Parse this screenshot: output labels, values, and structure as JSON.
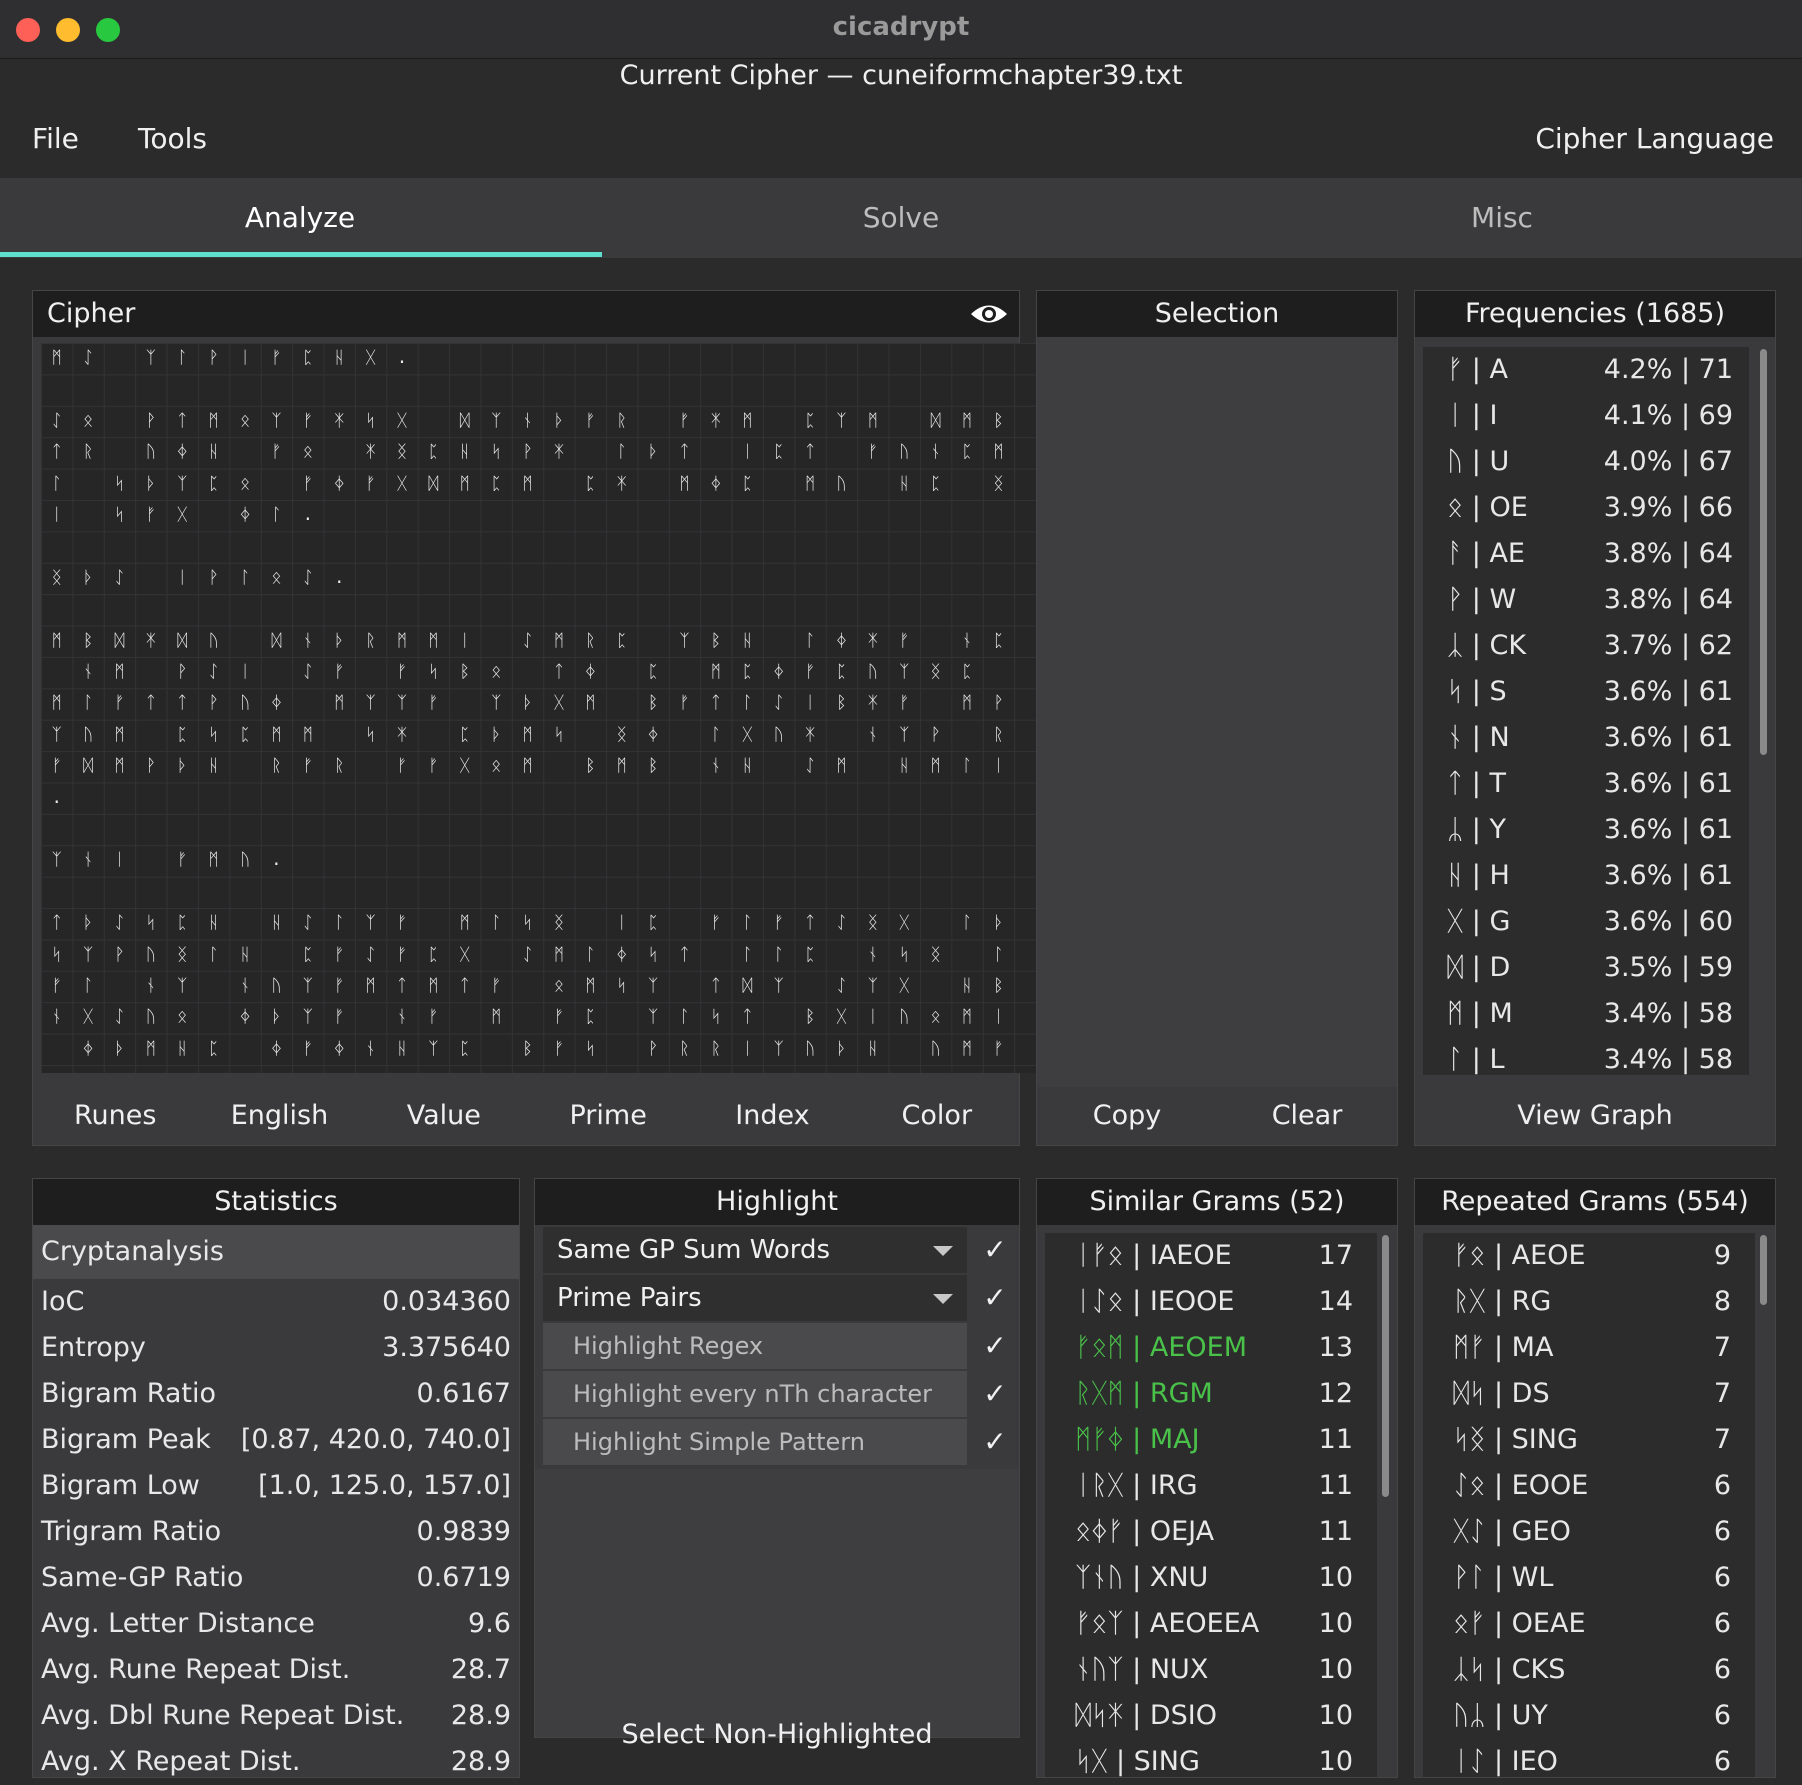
{
  "window": {
    "app_title": "cicadrypt",
    "subtitle": "Current Cipher — cuneiformchapter39.txt"
  },
  "menu": {
    "file": "File",
    "tools": "Tools",
    "cipher_language": "Cipher Language"
  },
  "tabs": [
    "Analyze",
    "Solve",
    "Misc"
  ],
  "cipher": {
    "title": "Cipher",
    "buttons": [
      "Runes",
      "English",
      "Value",
      "Prime",
      "Index",
      "Color"
    ],
    "rows": [
      [
        "ᛗ",
        "ᛇ",
        "",
        "ᛉ",
        "ᛚ",
        "ᚹ",
        "ᛁ",
        "ᚠ",
        "ᛈ",
        "ᚺ",
        "ᚷ",
        "."
      ],
      [],
      [
        "ᛇ",
        "ᛟ",
        "",
        "ᚹ",
        "ᛏ",
        "ᛗ",
        "ᛟ",
        "ᛉ",
        "ᚠ",
        "ᛡ",
        "ᛋ",
        "ᚷ",
        "",
        "ᛞ",
        "ᛉ",
        "ᚾ",
        "ᚦ",
        "ᚠ",
        "ᚱ",
        "",
        "ᚠ",
        "ᛡ",
        "ᛗ",
        "",
        "ᛈ",
        "ᛉ",
        "ᛗ",
        "",
        "ᛞ",
        "ᛗ",
        "ᛒ"
      ],
      [
        "ᛏ",
        "ᚱ",
        "",
        "ᚢ",
        "ᛄ",
        "ᚺ",
        "",
        "ᚠ",
        "ᛟ",
        "",
        "ᛡ",
        "ᛝ",
        "ᛈ",
        "ᚺ",
        "ᛋ",
        "ᚹ",
        "ᛡ",
        "",
        "ᛚ",
        "ᚦ",
        "ᛏ",
        "",
        "ᛁ",
        "ᛈ",
        "ᛏ",
        "",
        "ᚠ",
        "ᚢ",
        "ᚾ",
        "ᛈ",
        "ᛗ"
      ],
      [
        "ᛚ",
        "",
        "ᛋ",
        "ᚦ",
        "ᛉ",
        "ᛈ",
        "ᛟ",
        "",
        "ᚠ",
        "ᛄ",
        "ᚠ",
        "ᚷ",
        "ᛞ",
        "ᛗ",
        "ᛈ",
        "ᛗ",
        "",
        "ᛈ",
        "ᛡ",
        "",
        "ᛗ",
        "ᛄ",
        "ᛈ",
        "",
        "ᛗ",
        "ᚢ",
        "",
        "ᚺ",
        "ᛈ",
        "",
        "ᛝ"
      ],
      [
        "ᛁ",
        "",
        "ᛋ",
        "ᚠ",
        "ᚷ",
        "",
        "ᛄ",
        "ᛚ",
        "."
      ],
      [],
      [
        "ᛝ",
        "ᚦ",
        "ᛇ",
        "",
        "ᛁ",
        "ᚹ",
        "ᛚ",
        "ᛟ",
        "ᛇ",
        "."
      ],
      [],
      [
        "ᛗ",
        "ᛒ",
        "ᛞ",
        "ᛡ",
        "ᛞ",
        "ᚢ",
        "",
        "ᛞ",
        "ᚾ",
        "ᚦ",
        "ᚱ",
        "ᛗ",
        "ᛗ",
        "ᛁ",
        "",
        "ᛇ",
        "ᛗ",
        "ᚱ",
        "ᛈ",
        "",
        "ᛉ",
        "ᛒ",
        "ᚺ",
        "",
        "ᛚ",
        "ᛄ",
        "ᛡ",
        "ᚠ",
        "",
        "ᚾ",
        "ᛈ"
      ],
      [
        "",
        "ᚾ",
        "ᛗ",
        "",
        "ᚹ",
        "ᛇ",
        "ᛁ",
        "",
        "ᛇ",
        "ᚠ",
        "",
        "ᚠ",
        "ᛋ",
        "ᛒ",
        "ᛟ",
        "",
        "ᛏ",
        "ᛄ",
        "",
        "ᛈ",
        "",
        "ᛗ",
        "ᛈ",
        "ᛄ",
        "ᚠ",
        "ᛈ",
        "ᚢ",
        "ᛉ",
        "ᛝ",
        "ᛈ"
      ],
      [
        "ᛗ",
        "ᛚ",
        "ᚠ",
        "ᛏ",
        "ᛏ",
        "ᚹ",
        "ᚢ",
        "ᛄ",
        "",
        "ᛗ",
        "ᛉ",
        "ᛉ",
        "ᚠ",
        "",
        "ᛉ",
        "ᚦ",
        "ᚷ",
        "ᛗ",
        "",
        "ᛒ",
        "ᚠ",
        "ᛏ",
        "ᛚ",
        "ᛇ",
        "ᛁ",
        "ᛒ",
        "ᛡ",
        "ᚠ",
        "",
        "ᛗ",
        "ᚹ"
      ],
      [
        "ᛉ",
        "ᚢ",
        "ᛗ",
        "",
        "ᛈ",
        "ᛋ",
        "ᛈ",
        "ᛗ",
        "ᛗ",
        "",
        "ᛋ",
        "ᛡ",
        "",
        "ᛈ",
        "ᚦ",
        "ᛗ",
        "ᛋ",
        "",
        "ᛝ",
        "ᛄ",
        "",
        "ᛚ",
        "ᚷ",
        "ᚢ",
        "ᛡ",
        "",
        "ᚾ",
        "ᛉ",
        "ᚹ",
        "",
        "ᚱ"
      ],
      [
        "ᚠ",
        "ᛞ",
        "ᛗ",
        "ᚹ",
        "ᚦ",
        "ᚺ",
        "",
        "ᚱ",
        "ᚠ",
        "ᚱ",
        "",
        "ᚠ",
        "ᚠ",
        "ᚷ",
        "ᛟ",
        "ᛗ",
        "",
        "ᛒ",
        "ᛗ",
        "ᛒ",
        "",
        "ᚾ",
        "ᚺ",
        "",
        "ᛇ",
        "ᛗ",
        "",
        "ᚺ",
        "ᛗ",
        "ᛚ",
        "ᛁ"
      ],
      [
        "."
      ],
      [],
      [
        "ᛉ",
        "ᚾ",
        "ᛁ",
        "",
        "ᚠ",
        "ᛗ",
        "ᚢ",
        "."
      ],
      [],
      [
        "ᛏ",
        "ᚦ",
        "ᛇ",
        "ᛋ",
        "ᛈ",
        "ᚺ",
        "",
        "ᚺ",
        "ᛇ",
        "ᛚ",
        "ᛉ",
        "ᚠ",
        "",
        "ᛗ",
        "ᛚ",
        "ᛋ",
        "ᛝ",
        "",
        "ᛁ",
        "ᛈ",
        "",
        "ᚠ",
        "ᛚ",
        "ᚠ",
        "ᛏ",
        "ᛇ",
        "ᛝ",
        "ᚷ",
        "",
        "ᛚ",
        "ᚦ"
      ],
      [
        "ᛋ",
        "ᛉ",
        "ᚹ",
        "ᚢ",
        "ᛝ",
        "ᛚ",
        "ᚺ",
        "",
        "ᛈ",
        "ᚠ",
        "ᛇ",
        "ᚠ",
        "ᛈ",
        "ᚷ",
        "",
        "ᛇ",
        "ᛗ",
        "ᛚ",
        "ᛄ",
        "ᛋ",
        "ᛏ",
        "",
        "ᛚ",
        "ᛚ",
        "ᛈ",
        "",
        "ᚾ",
        "ᛋ",
        "ᛝ",
        "",
        "ᛚ"
      ],
      [
        "ᚠ",
        "ᛚ",
        "",
        "ᚾ",
        "ᛉ",
        "",
        "ᚾ",
        "ᚢ",
        "ᛉ",
        "ᚠ",
        "ᛗ",
        "ᛏ",
        "ᛗ",
        "ᛏ",
        "ᚠ",
        "",
        "ᛟ",
        "ᛗ",
        "ᛋ",
        "ᛉ",
        "",
        "ᛏ",
        "ᛞ",
        "ᛉ",
        "",
        "ᛇ",
        "ᛉ",
        "ᚷ",
        "",
        "ᚺ",
        "ᛒ"
      ],
      [
        "ᚾ",
        "ᚷ",
        "ᛇ",
        "ᚢ",
        "ᛟ",
        "",
        "ᛄ",
        "ᚦ",
        "ᛉ",
        "ᚠ",
        "",
        "ᚾ",
        "ᚠ",
        "",
        "ᛗ",
        "",
        "ᚠ",
        "ᛈ",
        "",
        "ᛉ",
        "ᛚ",
        "ᛋ",
        "ᛏ",
        "",
        "ᛒ",
        "ᚷ",
        "ᛁ",
        "ᚢ",
        "ᛟ",
        "ᛗ",
        "ᛁ"
      ],
      [
        "",
        "ᛄ",
        "ᚦ",
        "ᛗ",
        "ᚺ",
        "ᛈ",
        "",
        "ᛄ",
        "ᚠ",
        "ᛄ",
        "ᚾ",
        "ᚺ",
        "ᛉ",
        "ᛈ",
        "",
        "ᛒ",
        "ᚠ",
        "ᛋ",
        "",
        "ᚹ",
        "ᚱ",
        "ᚱ",
        "ᛁ",
        "ᛉ",
        "ᚢ",
        "ᚦ",
        "ᚺ",
        "",
        "ᚢ",
        "ᛗ",
        "ᚠ"
      ]
    ]
  },
  "selection": {
    "title": "Selection",
    "buttons": [
      "Copy",
      "Clear"
    ]
  },
  "frequencies": {
    "title": "Frequencies (1685)",
    "button": "View Graph",
    "items": [
      {
        "label": "ᚠ | A",
        "value": "4.2% | 71"
      },
      {
        "label": "ᛁ | I",
        "value": "4.1% | 69"
      },
      {
        "label": "ᚢ | U",
        "value": "4.0% | 67"
      },
      {
        "label": "ᛟ | OE",
        "value": "3.9% | 66"
      },
      {
        "label": "ᚨ | AE",
        "value": "3.8% | 64"
      },
      {
        "label": "ᚹ | W",
        "value": "3.8% | 64"
      },
      {
        "label": "ᛣ | CK",
        "value": "3.7% | 62"
      },
      {
        "label": "ᛋ | S",
        "value": "3.6% | 61"
      },
      {
        "label": "ᚾ | N",
        "value": "3.6% | 61"
      },
      {
        "label": "ᛏ | T",
        "value": "3.6% | 61"
      },
      {
        "label": "ᛦ | Y",
        "value": "3.6% | 61"
      },
      {
        "label": "ᚺ | H",
        "value": "3.6% | 61"
      },
      {
        "label": "ᚷ | G",
        "value": "3.6% | 60"
      },
      {
        "label": "ᛞ | D",
        "value": "3.5% | 59"
      },
      {
        "label": "ᛗ | M",
        "value": "3.4% | 58"
      },
      {
        "label": "ᛚ | L",
        "value": "3.4% | 58"
      }
    ]
  },
  "statistics": {
    "title": "Statistics",
    "subheader": "Cryptanalysis",
    "rows": [
      {
        "label": "IoC",
        "value": "0.034360"
      },
      {
        "label": "Entropy",
        "value": "3.375640"
      },
      {
        "label": "Bigram Ratio",
        "value": "0.6167"
      },
      {
        "label": "Bigram Peak",
        "value": "[0.87, 420.0, 740.0]"
      },
      {
        "label": "Bigram Low",
        "value": "[1.0, 125.0, 157.0]"
      },
      {
        "label": "Trigram Ratio",
        "value": "0.9839"
      },
      {
        "label": "Same-GP Ratio",
        "value": "0.6719"
      },
      {
        "label": "Avg. Letter Distance",
        "value": "9.6"
      },
      {
        "label": "Avg. Rune Repeat Dist.",
        "value": "28.7"
      },
      {
        "label": "Avg. Dbl Rune Repeat Dist.",
        "value": "28.9"
      },
      {
        "label": "Avg. X Repeat Dist.",
        "value": "28.9"
      }
    ]
  },
  "highlight": {
    "title": "Highlight",
    "items": [
      "Same GP Sum Words",
      "Prime Pairs",
      "Highlight Regex",
      "Highlight every nTh character",
      "Highlight Simple Pattern"
    ],
    "bottom_button": "Select Non-Highlighted"
  },
  "similar_grams": {
    "title": "Similar Grams (52)",
    "items": [
      {
        "label": "ᛁᚠᛟ | IAEOE",
        "value": "17"
      },
      {
        "label": "ᛁᛇᛟ | IEOOE",
        "value": "14"
      },
      {
        "label": "ᚠᛟᛗ | AEOEM",
        "value": "13"
      },
      {
        "label": "ᚱᚷᛗ | RGM",
        "value": "12"
      },
      {
        "label": "ᛗᚠᛄ | MAJ",
        "value": "11"
      },
      {
        "label": "ᛁᚱᚷ | IRG",
        "value": "11"
      },
      {
        "label": "ᛟᛄᚠ | OEJA",
        "value": "11"
      },
      {
        "label": "ᛉᚾᚢ | XNU",
        "value": "10"
      },
      {
        "label": "ᚠᛟᛉ | AEOEEA",
        "value": "10"
      },
      {
        "label": "ᚾᚢᛉ | NUX",
        "value": "10"
      },
      {
        "label": "ᛞᛋᛡ | DSIO",
        "value": "10"
      },
      {
        "label": "ᛋᚷ | SING",
        "value": "10"
      }
    ],
    "highlighted_colors": {
      "green": "#4ac24a"
    }
  },
  "repeated_grams": {
    "title": "Repeated Grams (554)",
    "items": [
      {
        "label": "ᚠᛟ | AEOE",
        "value": "9"
      },
      {
        "label": "ᚱᚷ | RG",
        "value": "8"
      },
      {
        "label": "ᛗᚠ | MA",
        "value": "7"
      },
      {
        "label": "ᛞᛋ | DS",
        "value": "7"
      },
      {
        "label": "ᛋᛝ | SING",
        "value": "7"
      },
      {
        "label": "ᛇᛟ | EOOE",
        "value": "6"
      },
      {
        "label": "ᚷᛇ | GEO",
        "value": "6"
      },
      {
        "label": "ᚹᛚ | WL",
        "value": "6"
      },
      {
        "label": "ᛟᚠ | OEAE",
        "value": "6"
      },
      {
        "label": "ᛣᛋ | CKS",
        "value": "6"
      },
      {
        "label": "ᚢᛦ | UY",
        "value": "6"
      },
      {
        "label": "ᛁᛇ | IEO",
        "value": "6"
      }
    ]
  }
}
